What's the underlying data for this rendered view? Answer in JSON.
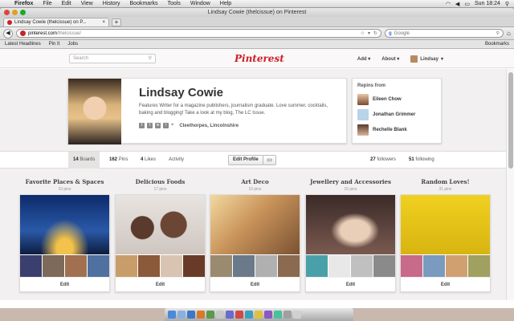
{
  "menubar": {
    "items": [
      "Firefox",
      "File",
      "Edit",
      "View",
      "History",
      "Bookmarks",
      "Tools",
      "Window",
      "Help"
    ],
    "clock": "Sun 18:24"
  },
  "browser": {
    "window_title": "Lindsay Cowie (thelcissue) on Pinterest",
    "tab_title": "Lindsay Cowie (thelcissue) on P...",
    "url_host": "pinterest.com",
    "url_path": "/thelcissue/",
    "search_placeholder": "Google",
    "bookmarks": [
      "Latest Headlines",
      "Pin It",
      "Jobs"
    ],
    "bookmarks_menu": "Bookmarks"
  },
  "header": {
    "search_placeholder": "Search",
    "logo": "Pinterest",
    "add": "Add",
    "about": "About",
    "user": "Lindsay"
  },
  "profile": {
    "name": "Lindsay Cowie",
    "bio": "Features Writer for a magazine publishers, journalism graduate. Love summer, cocktails, baking and blogging! Take a look at my blog, The LC Issue.",
    "location": "Cleethorpes, Lincolnshire"
  },
  "repins": {
    "title": "Repins from",
    "people": [
      "Eileen Chow",
      "Jonathan Grimmer",
      "Rechelle Blank"
    ]
  },
  "stats": {
    "boards": "14",
    "boards_label": "Boards",
    "pins": "162",
    "pins_label": "Pins",
    "likes": "4",
    "likes_label": "Likes",
    "activity": "Activity",
    "edit_profile": "Edit Profile",
    "followers": "27",
    "followers_label": "followers",
    "following": "51",
    "following_label": "following"
  },
  "boards": [
    {
      "title": "Favorite Places & Spaces",
      "count": "10 pins",
      "edit": "Edit"
    },
    {
      "title": "Delicious Foods",
      "count": "17 pins",
      "edit": "Edit"
    },
    {
      "title": "Art Deco",
      "count": "10 pins",
      "edit": "Edit"
    },
    {
      "title": "Jewellery and Accessories",
      "count": "15 pins",
      "edit": "Edit"
    },
    {
      "title": "Random Loves!",
      "count": "31 pins",
      "edit": "Edit"
    }
  ],
  "colors": {
    "brand": "#cb2027"
  }
}
